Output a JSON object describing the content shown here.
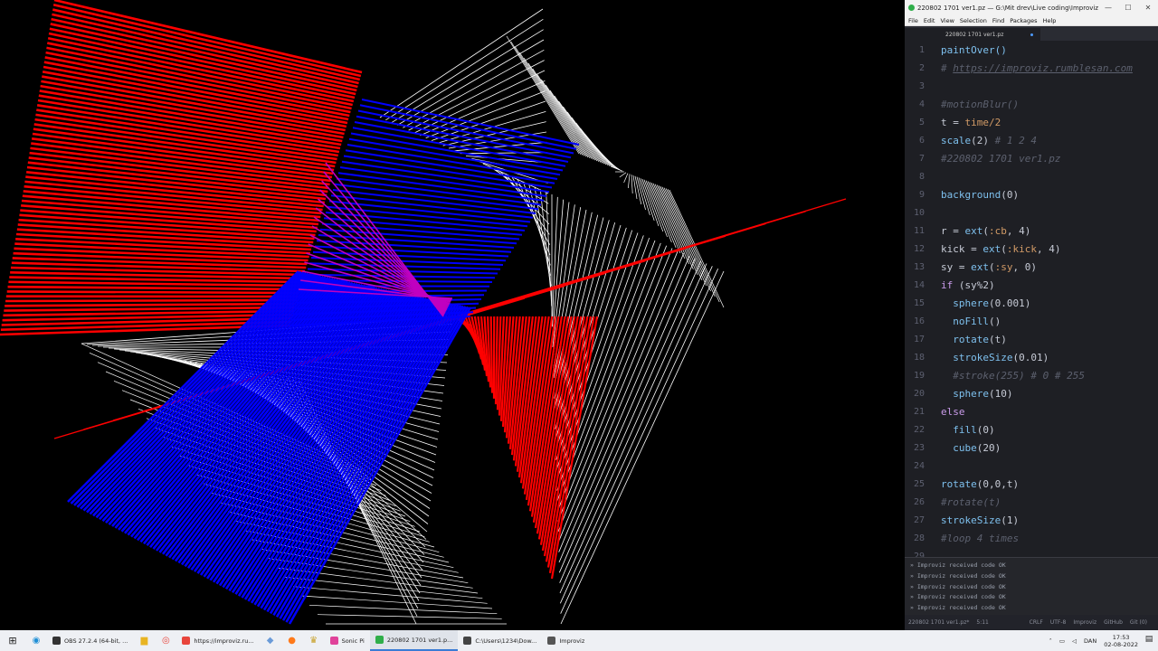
{
  "window": {
    "title": "220802 1701 ver1.pz — G:\\Mit drev\\Live coding\\Improviz ...",
    "min": "—",
    "max": "☐",
    "close": "✕"
  },
  "menu": [
    "File",
    "Edit",
    "View",
    "Selection",
    "Find",
    "Packages",
    "Help"
  ],
  "tab": {
    "label": "220802 1701 ver1.pz"
  },
  "code": [
    {
      "n": "1",
      "tokens": [
        [
          "fn",
          "paintOver()"
        ]
      ]
    },
    {
      "n": "2",
      "tokens": [
        [
          "cm",
          "# "
        ],
        [
          "str",
          "https://improviz.rumblesan.com"
        ]
      ]
    },
    {
      "n": "3",
      "tokens": []
    },
    {
      "n": "4",
      "tokens": [
        [
          "cm",
          "#motionBlur()"
        ]
      ]
    },
    {
      "n": "5",
      "tokens": [
        [
          "tx",
          "t = "
        ],
        [
          "num",
          "time/2"
        ]
      ]
    },
    {
      "n": "6",
      "tokens": [
        [
          "fn",
          "scale"
        ],
        [
          "tx",
          "(2) "
        ],
        [
          "cm",
          "# 1 2 4"
        ]
      ]
    },
    {
      "n": "7",
      "tokens": [
        [
          "cm",
          "#220802 1701 ver1.pz"
        ]
      ]
    },
    {
      "n": "8",
      "tokens": []
    },
    {
      "n": "9",
      "tokens": [
        [
          "fn",
          "background"
        ],
        [
          "tx",
          "(0)"
        ]
      ]
    },
    {
      "n": "10",
      "tokens": []
    },
    {
      "n": "11",
      "tokens": [
        [
          "tx",
          "r = "
        ],
        [
          "fn",
          "ext"
        ],
        [
          "tx",
          "("
        ],
        [
          "sym",
          ":cb"
        ],
        [
          "tx",
          ", 4)"
        ]
      ]
    },
    {
      "n": "12",
      "tokens": [
        [
          "tx",
          "kick = "
        ],
        [
          "fn",
          "ext"
        ],
        [
          "tx",
          "("
        ],
        [
          "sym",
          ":kick"
        ],
        [
          "tx",
          ", 4)"
        ]
      ]
    },
    {
      "n": "13",
      "tokens": [
        [
          "tx",
          "sy = "
        ],
        [
          "fn",
          "ext"
        ],
        [
          "tx",
          "("
        ],
        [
          "sym",
          ":sy"
        ],
        [
          "tx",
          ", 0)"
        ]
      ]
    },
    {
      "n": "14",
      "tokens": [
        [
          "kw",
          "if"
        ],
        [
          "tx",
          " (sy%2)"
        ]
      ]
    },
    {
      "n": "15",
      "tokens": [
        [
          "tx",
          "  "
        ],
        [
          "fn",
          "sphere"
        ],
        [
          "tx",
          "(0.001)"
        ]
      ]
    },
    {
      "n": "16",
      "tokens": [
        [
          "tx",
          "  "
        ],
        [
          "fn",
          "noFill"
        ],
        [
          "tx",
          "()"
        ]
      ]
    },
    {
      "n": "17",
      "tokens": [
        [
          "tx",
          "  "
        ],
        [
          "fn",
          "rotate"
        ],
        [
          "tx",
          "(t)"
        ]
      ]
    },
    {
      "n": "18",
      "tokens": [
        [
          "tx",
          "  "
        ],
        [
          "fn",
          "strokeSize"
        ],
        [
          "tx",
          "(0.01)"
        ]
      ]
    },
    {
      "n": "19",
      "tokens": [
        [
          "tx",
          "  "
        ],
        [
          "cm",
          "#stroke(255) # 0 # 255"
        ]
      ]
    },
    {
      "n": "20",
      "tokens": [
        [
          "tx",
          "  "
        ],
        [
          "fn",
          "sphere"
        ],
        [
          "tx",
          "(10)"
        ]
      ]
    },
    {
      "n": "21",
      "tokens": [
        [
          "kw",
          "else"
        ]
      ]
    },
    {
      "n": "22",
      "tokens": [
        [
          "tx",
          "  "
        ],
        [
          "fn",
          "fill"
        ],
        [
          "tx",
          "(0)"
        ]
      ]
    },
    {
      "n": "23",
      "tokens": [
        [
          "tx",
          "  "
        ],
        [
          "fn",
          "cube"
        ],
        [
          "tx",
          "(20)"
        ]
      ]
    },
    {
      "n": "24",
      "tokens": []
    },
    {
      "n": "25",
      "tokens": [
        [
          "fn",
          "rotate"
        ],
        [
          "tx",
          "(0,0,t)"
        ]
      ]
    },
    {
      "n": "26",
      "tokens": [
        [
          "cm",
          "#rotate(t)"
        ]
      ]
    },
    {
      "n": "27",
      "tokens": [
        [
          "fn",
          "strokeSize"
        ],
        [
          "tx",
          "(1)"
        ]
      ]
    },
    {
      "n": "28",
      "tokens": [
        [
          "cm",
          "#loop 4 times"
        ]
      ]
    },
    {
      "n": "29",
      "tokens": []
    }
  ],
  "console": [
    "Improviz received code OK",
    "Improviz received code OK",
    "Improviz received code OK",
    "Improviz received code OK",
    "Improviz received code OK"
  ],
  "status": {
    "file": "220802 1701 ver1.pz*",
    "cursor": "5:11",
    "eol": "CRLF",
    "encoding": "UTF-8",
    "grammar": "Improviz",
    "github": "GitHub",
    "git": "Git (0)"
  },
  "taskbar": {
    "items": [
      {
        "label": "OBS 27.2.4 (64-bit, ...",
        "color": "#333333",
        "active": false
      },
      {
        "label": "https://improviz.ru...",
        "color": "#e8453c",
        "active": false
      },
      {
        "label": "Sonic Pi",
        "color": "#e0429a",
        "active": false
      },
      {
        "label": "220802 1701 ver1.p...",
        "color": "#2fae4a",
        "active": true
      },
      {
        "label": "C:\\Users\\1234\\Dow...",
        "color": "#444444",
        "active": false
      },
      {
        "label": "Improviz",
        "color": "#555555",
        "active": false
      }
    ],
    "lang": "DAN",
    "time": "17:53",
    "date": "02-08-2022"
  },
  "colors": {
    "red": "#ff0000",
    "blue": "#0000ff",
    "white": "#ffffff",
    "magenta": "#c000c0"
  }
}
